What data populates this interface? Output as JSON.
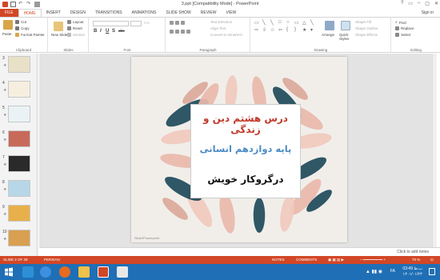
{
  "window": {
    "title": "3.ppt [Compatibility Mode] - PowerPoint",
    "controls": [
      "?",
      "▭",
      "–",
      "▢",
      "✕"
    ]
  },
  "tabs": [
    "FILE",
    "HOME",
    "INSERT",
    "DESIGN",
    "TRANSITIONS",
    "ANIMATIONS",
    "SLIDE SHOW",
    "REVIEW",
    "VIEW"
  ],
  "active_tab": "HOME",
  "signin": "Sign in",
  "ribbon": {
    "clipboard": {
      "paste": "Paste",
      "cut": "Cut",
      "copy": "Copy",
      "format_painter": "Format Painter",
      "label": "Clipboard"
    },
    "slides": {
      "new_slide": "New Slide",
      "layout": "Layout",
      "reset": "Reset",
      "section": "Section",
      "label": "Slides"
    },
    "font": {
      "label": "Font",
      "bold": "B",
      "italic": "I",
      "underline": "U",
      "shadow": "S",
      "strike": "abc"
    },
    "paragraph": {
      "text_direction": "Text Direction",
      "align_text": "Align Text",
      "convert_smartart": "Convert to SmartArt",
      "label": "Paragraph"
    },
    "drawing": {
      "arrange": "Arrange",
      "quick_styles": "Quick Styles",
      "shape_fill": "Shape Fill",
      "shape_outline": "Shape Outline",
      "shape_effects": "Shape Effects",
      "label": "Drawing"
    },
    "editing": {
      "find": "Find",
      "replace": "Replace",
      "select": "Select",
      "label": "Editing"
    }
  },
  "slide_panel": {
    "thumbnails": [
      {
        "num": "3",
        "color": "#e9e0c8"
      },
      {
        "num": "4",
        "color": "#f6efe0"
      },
      {
        "num": "5",
        "color": "#eaf2f5"
      },
      {
        "num": "6",
        "color": "#c86a5a"
      },
      {
        "num": "7",
        "color": "#2a2a2a"
      },
      {
        "num": "8",
        "color": "#b7d7e8"
      },
      {
        "num": "9",
        "color": "#e8b04a"
      },
      {
        "num": "10",
        "color": "#d8a050"
      }
    ]
  },
  "slide": {
    "line1": "درس هشتم دین و زندگی",
    "line2": "پایه دوازدهم انسانی",
    "line3": "درگروکار خویش",
    "watermark": "Slide2Powerpoint"
  },
  "notes": {
    "placeholder": "Click to add notes"
  },
  "status": {
    "slide_counter": "SLIDE 2 OF 29",
    "language": "PERSIAN",
    "notes": "NOTES",
    "comments": "COMMENTS",
    "zoom": "70 %"
  },
  "taskbar": {
    "time": "03:49 ب.ظ",
    "date": "۱۴۰۱/۰۱/۲۳",
    "lang": "FA"
  },
  "colors": {
    "accent": "#d24726",
    "taskbar": "#1f6fb6",
    "title_red": "#c0392b",
    "subtitle_blue": "#4a8bc4"
  }
}
